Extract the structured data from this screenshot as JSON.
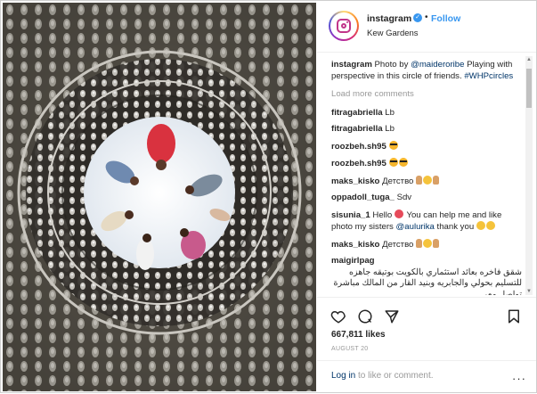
{
  "header": {
    "username": "instagram",
    "follow_label": "Follow",
    "separator": "•",
    "location": "Kew Gardens"
  },
  "caption": {
    "username": "instagram",
    "text_prefix": "Photo by ",
    "mention": "@maideroribe",
    "text_body": "Playing with perspective in this circle of friends.",
    "hashtag": "#WHPcircles"
  },
  "load_more_label": "Load more comments",
  "comments": [
    {
      "user": "fitragabriella",
      "text": "Lb",
      "emoji": []
    },
    {
      "user": "fitragabriella",
      "text": "Lb",
      "emoji": []
    },
    {
      "user": "roozbeh.sh95",
      "text": "",
      "emoji": [
        "cool-emoji"
      ]
    },
    {
      "user": "roozbeh.sh95",
      "text": "",
      "emoji": [
        "cool-emoji",
        "cool-emoji"
      ]
    },
    {
      "user": "maks_kisko",
      "text": "Детство",
      "emoji": [
        "hand-emoji",
        "smile-emoji",
        "hand-emoji"
      ]
    },
    {
      "user": "oppadoll_tuga_",
      "text": "Sdv",
      "emoji": []
    },
    {
      "user": "sisunia_1",
      "text": "Hello",
      "emoji": [
        "heart-eyes-emoji"
      ],
      "text2": "You can help me and like photo my sisters",
      "mention": "@aulurika",
      "text3": "thank you",
      "emoji2": [
        "smile-emoji",
        "smile-emoji"
      ]
    },
    {
      "user": "maks_kisko",
      "text": "Детство",
      "emoji": [
        "hand-emoji",
        "smile-emoji",
        "hand-emoji"
      ]
    },
    {
      "user": "maigirlpag",
      "text": "شقق فاخره بعائد استثماري بالكويت بوتيقه جاهزه للتسليم بحولي والجابريه وبنيد القار من المالك مباشرة تواصل معي",
      "emoji": []
    }
  ],
  "likes": "667,811 likes",
  "date": "AUGUST 20",
  "login": {
    "link_text": "Log in",
    "rest_text": " to like or comment."
  },
  "icons": [
    "heart-icon",
    "comment-icon",
    "share-icon",
    "bookmark-icon",
    "more-icon",
    "verified-icon"
  ],
  "colors": {
    "accent": "#3897f0",
    "link": "#003569",
    "muted": "#999999"
  }
}
